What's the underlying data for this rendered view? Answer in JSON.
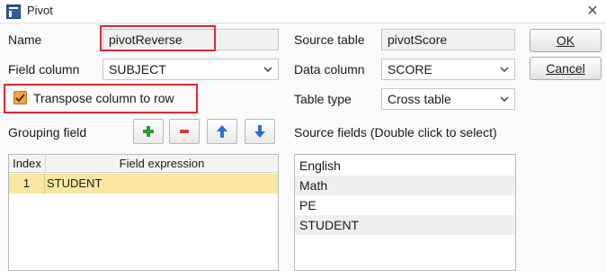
{
  "window": {
    "title": "Pivot",
    "close_glyph": "✕"
  },
  "form": {
    "name_label": "Name",
    "name_value": "pivotReverse",
    "field_column_label": "Field column",
    "field_column_value": "SUBJECT",
    "transpose_label": "Transpose column to row",
    "transpose_checked": true,
    "grouping_field_label": "Grouping field",
    "source_table_label": "Source table",
    "source_table_value": "pivotScore",
    "data_column_label": "Data column",
    "data_column_value": "SCORE",
    "table_type_label": "Table type",
    "table_type_value": "Cross table",
    "source_fields_label": "Source fields (Double click to select)"
  },
  "buttons": {
    "ok": "OK",
    "cancel": "Cancel"
  },
  "grouping_table": {
    "columns": [
      "Index",
      "Field expression"
    ],
    "rows": [
      {
        "index": "1",
        "expression": "STUDENT"
      }
    ]
  },
  "source_fields": [
    "English",
    "Math",
    "PE",
    "STUDENT"
  ],
  "colors": {
    "highlight": "#e0282e",
    "selected_row": "#fbe7a1",
    "checkbox": "#f3a33a",
    "add_icon": "#2c9a2c",
    "remove_icon": "#d93a3a",
    "arrow_icon": "#2b6fd1"
  },
  "icons": {
    "add": "plus-icon",
    "remove": "minus-icon",
    "move_up": "arrow-up-icon",
    "move_down": "arrow-down-icon",
    "dropdown": "chevron-down-icon",
    "check": "check-icon",
    "close": "close-icon",
    "app": "pivot-app-icon"
  }
}
